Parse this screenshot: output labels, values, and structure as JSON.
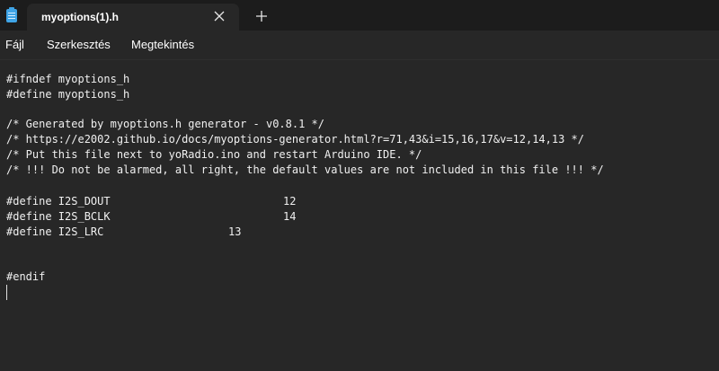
{
  "window": {
    "icon": "notepad-icon",
    "tab_title": "myoptions(1).h"
  },
  "menu": {
    "items": [
      "Fájl",
      "Szerkesztés",
      "Megtekintés"
    ]
  },
  "editor": {
    "lines": [
      "#ifndef myoptions_h",
      "#define myoptions_h",
      "/* Generated by myoptions.h generator - v0.8.1 */",
      "/* https://e2002.github.io/docs/myoptions-generator.html?r=71,43&i=15,16,17&v=12,14,13 */",
      "/* Put this file next to yoRadio.ino and restart Arduino IDE. */",
      "/* !!! Do not be alarmed, all right, the default values are not included in this file !!! */",
      "#define I2S_DOUT",
      "#define I2S_BCLK",
      "#define I2S_LRC",
      "#endif"
    ],
    "define_values": [
      "12",
      "14",
      "13"
    ]
  },
  "colors": {
    "background": "#272727",
    "titlebar": "#1c1c1c",
    "icon_accent": "#3fa4e6",
    "text": "#ffffff"
  }
}
